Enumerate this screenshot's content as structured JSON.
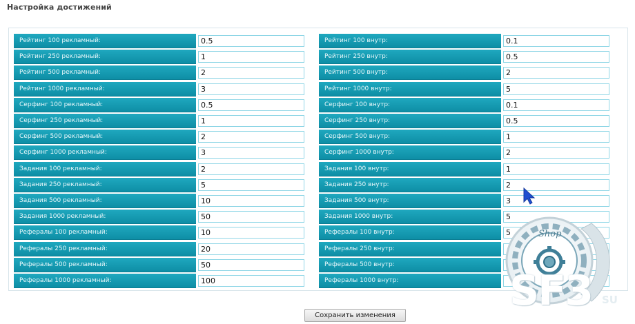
{
  "page": {
    "title": "Настройка достижений"
  },
  "left_fields": [
    {
      "label": "Рейтинг 100 рекламный:",
      "value": "0.5"
    },
    {
      "label": "Рейтинг 250 рекламный:",
      "value": "1"
    },
    {
      "label": "Рейтинг 500 рекламный:",
      "value": "2"
    },
    {
      "label": "Рейтинг 1000 рекламный:",
      "value": "3"
    },
    {
      "label": "Серфинг 100 рекламный:",
      "value": "0.5"
    },
    {
      "label": "Серфинг 250 рекламный:",
      "value": "1"
    },
    {
      "label": "Серфинг 500 рекламный:",
      "value": "2"
    },
    {
      "label": "Серфинг 1000 рекламный:",
      "value": "3"
    },
    {
      "label": "Задания 100 рекламный:",
      "value": "2"
    },
    {
      "label": "Задания 250 рекламный:",
      "value": "5"
    },
    {
      "label": "Задания 500 рекламный:",
      "value": "10"
    },
    {
      "label": "Задания 1000 рекламный:",
      "value": "50"
    },
    {
      "label": "Рефералы 100 рекламный:",
      "value": "10"
    },
    {
      "label": "Рефералы 250 рекламный:",
      "value": "20"
    },
    {
      "label": "Рефералы 500 рекламный:",
      "value": "50"
    },
    {
      "label": "Рефералы 1000 рекламный:",
      "value": "100"
    }
  ],
  "right_fields": [
    {
      "label": "Рейтинг 100 внутр:",
      "value": "0.1"
    },
    {
      "label": "Рейтинг 250 внутр:",
      "value": "0.5"
    },
    {
      "label": "Рейтинг 500 внутр:",
      "value": "2"
    },
    {
      "label": "Рейтинг 1000 внутр:",
      "value": "5"
    },
    {
      "label": "Серфинг 100 внутр:",
      "value": "0.1"
    },
    {
      "label": "Серфинг 250 внутр:",
      "value": "0.5"
    },
    {
      "label": "Серфинг 500 внутр:",
      "value": "1"
    },
    {
      "label": "Серфинг 1000 внутр:",
      "value": "2"
    },
    {
      "label": "Задания 100 внутр:",
      "value": "1"
    },
    {
      "label": "Задания 250 внутр:",
      "value": "2"
    },
    {
      "label": "Задания 500 внутр:",
      "value": "3"
    },
    {
      "label": "Задания 1000 внутр:",
      "value": "5"
    },
    {
      "label": "Рефералы 100 внутр:",
      "value": "5"
    },
    {
      "label": "Рефералы 250 внутр:",
      "value": ""
    },
    {
      "label": "Рефералы 500 внутр:",
      "value": ""
    },
    {
      "label": "Рефералы 1000 внутр:",
      "value": ""
    }
  ],
  "actions": {
    "save_label": "Сохранить изменения"
  },
  "watermark": {
    "shop_text": "Shop",
    "brand_text": "SF3",
    "tld_text": "SU",
    "icon": "gear-logo-icon"
  },
  "colors": {
    "label_bg": "#1296ad",
    "input_border": "#8fd6e6",
    "accent_cursor": "#1f4fd1"
  }
}
